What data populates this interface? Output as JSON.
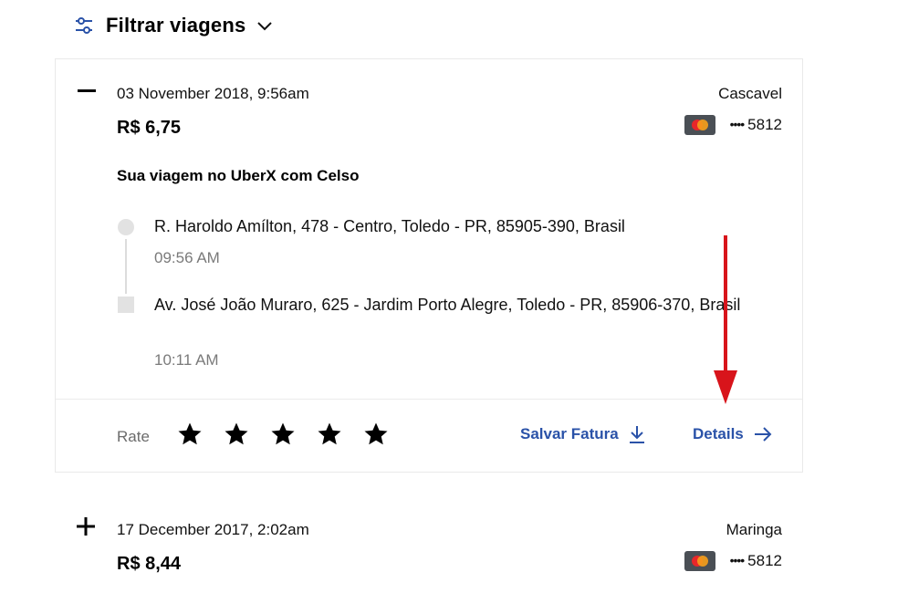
{
  "filter": {
    "title": "Filtrar viagens",
    "icon": "sliders-icon"
  },
  "trips": [
    {
      "expanded": true,
      "datetime": "03 November 2018, 9:56am",
      "city": "Cascavel",
      "price": "R$ 6,75",
      "card_masked": "••••",
      "card_last4": "5812",
      "title": "Sua viagem no UberX com Celso",
      "pickup": {
        "address": "R. Haroldo Amílton, 478 - Centro, Toledo - PR, 85905-390, Brasil",
        "time": "09:56 AM"
      },
      "dropoff": {
        "address": "Av. José João Muraro, 625 - Jardim Porto Alegre, Toledo - PR, 85906-370, Brasil",
        "time": "10:11 AM"
      },
      "rate_label": "Rate",
      "stars": 5,
      "save_invoice": "Salvar Fatura",
      "details": "Details"
    },
    {
      "expanded": false,
      "datetime": "17 December 2017, 2:02am",
      "city": "Maringa",
      "price": "R$ 8,44",
      "card_masked": "••••",
      "card_last4": "5812"
    }
  ],
  "colors": {
    "link": "#2a52a8",
    "annotation_arrow": "#d8141b",
    "card_brand_bg": "#4a4f55"
  }
}
